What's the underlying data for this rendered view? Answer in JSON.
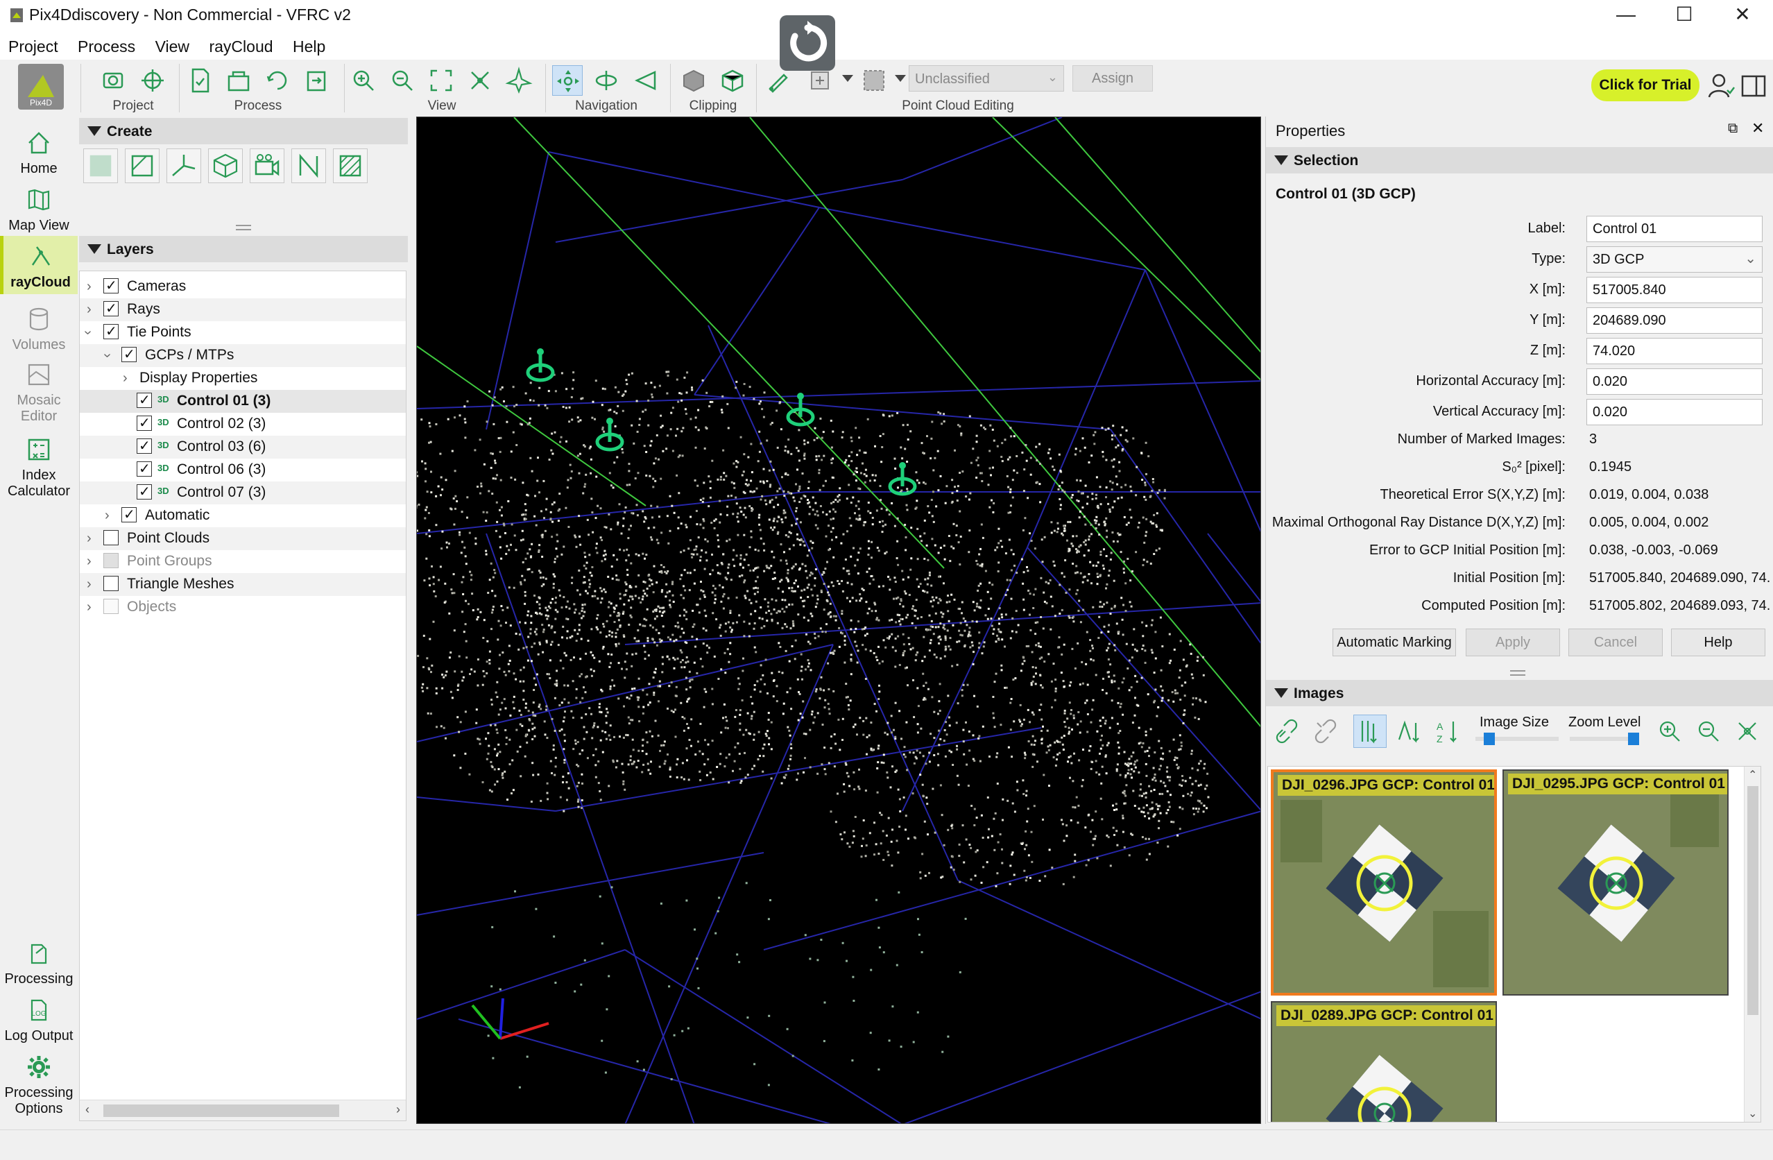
{
  "window": {
    "title": "Pix4Ddiscovery - Non Commercial - VFRC v2",
    "controls": {
      "minimize": "—",
      "maximize": "☐",
      "close": "✕"
    }
  },
  "menu": [
    "Project",
    "Process",
    "View",
    "rayCloud",
    "Help"
  ],
  "toolbar": {
    "groups": [
      "Project",
      "Process",
      "View",
      "Navigation",
      "Clipping",
      "Point Cloud Editing"
    ],
    "class_select": "Unclassified",
    "assign": "Assign",
    "trial": "Click for Trial",
    "logo": "Pix4D"
  },
  "leftnav": {
    "home": "Home",
    "map_view": "Map View",
    "raycloud": "rayCloud",
    "volumes": "Volumes",
    "mosaic_editor_1": "Mosaic",
    "mosaic_editor_2": "Editor",
    "index_calc_1": "Index",
    "index_calc_2": "Calculator",
    "processing": "Processing",
    "log_output": "Log Output",
    "processing_options_1": "Processing",
    "processing_options_2": "Options"
  },
  "create": {
    "header": "Create"
  },
  "layers": {
    "header": "Layers",
    "cameras": "Cameras",
    "rays": "Rays",
    "tie_points": "Tie Points",
    "gcps": "GCPs / MTPs",
    "display_props": "Display Properties",
    "gcp_icon": "3D",
    "control_01": "Control 01 (3)",
    "control_02": "Control 02 (3)",
    "control_03": "Control 03 (6)",
    "control_06": "Control 06 (3)",
    "control_07": "Control 07 (3)",
    "automatic": "Automatic",
    "point_clouds": "Point Clouds",
    "point_groups": "Point Groups",
    "triangle_meshes": "Triangle Meshes",
    "objects": "Objects"
  },
  "properties": {
    "title": "Properties",
    "selection_header": "Selection",
    "selected": "Control 01 (3D GCP)",
    "label_k": "Label:",
    "label_v": "Control 01",
    "type_k": "Type:",
    "type_v": "3D GCP",
    "x_k": "X [m]:",
    "x_v": "517005.840",
    "y_k": "Y [m]:",
    "y_v": "204689.090",
    "z_k": "Z [m]:",
    "z_v": "74.020",
    "hacc_k": "Horizontal Accuracy [m]:",
    "hacc_v": "0.020",
    "vacc_k": "Vertical Accuracy [m]:",
    "vacc_v": "0.020",
    "nmarked_k": "Number of Marked Images:",
    "nmarked_v": "3",
    "s0_k": "S₀² [pixel]:",
    "s0_v": "0.1945",
    "theo_k": "Theoretical Error S(X,Y,Z) [m]:",
    "theo_v": "0.019, 0.004, 0.038",
    "maxray_k": "Maximal Orthogonal Ray Distance D(X,Y,Z) [m]:",
    "maxray_v": "0.005, 0.004, 0.002",
    "errgcp_k": "Error to GCP Initial Position [m]:",
    "errgcp_v": "0.038, -0.003, -0.069",
    "initpos_k": "Initial Position [m]:",
    "initpos_v": "517005.840, 204689.090, 74.",
    "comppos_k": "Computed Position [m]:",
    "comppos_v": "517005.802, 204689.093, 74.",
    "btn_auto": "Automatic Marking",
    "btn_apply": "Apply",
    "btn_cancel": "Cancel",
    "btn_help": "Help"
  },
  "images": {
    "header": "Images",
    "image_size": "Image Size",
    "zoom_level": "Zoom Level",
    "tiles": [
      {
        "name": "DJI_0296.JPG",
        "gcp": "GCP: Control 01"
      },
      {
        "name": "DJI_0295.JPG",
        "gcp": "GCP: Control 01"
      },
      {
        "name": "DJI_0289.JPG",
        "gcp": "GCP: Control 01"
      }
    ]
  }
}
